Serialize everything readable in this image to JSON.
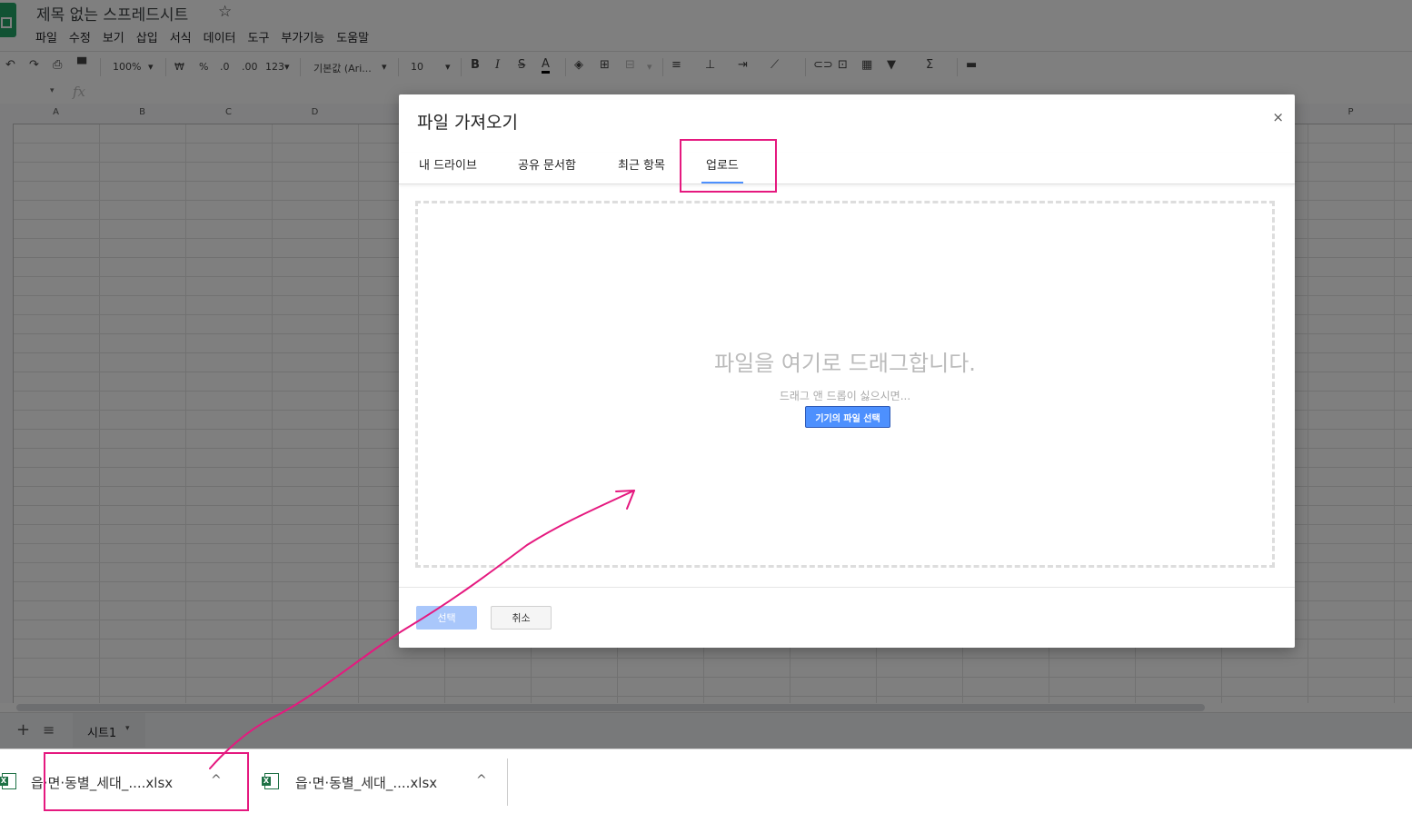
{
  "app": {
    "doc_title": "제목 없는 스프레드시트",
    "star_icon": "☆",
    "menu": [
      "파일",
      "수정",
      "보기",
      "삽입",
      "서식",
      "데이터",
      "도구",
      "부가기능",
      "도움말"
    ]
  },
  "toolbar": {
    "undo": "↶",
    "redo": "↷",
    "zoom": "100%",
    "currency": "₩",
    "percent": "%",
    "decimal_decrease": ".0",
    "decimal_increase": ".00",
    "number_format": "123▾",
    "font": "기본값 (Ari...",
    "font_size": "10",
    "bold": "B",
    "italic": "I",
    "strike": "S",
    "text_color": "A",
    "sum": "Σ",
    "dropdown_arrow": "▾"
  },
  "formula_bar": {
    "fx": "fx"
  },
  "columns": [
    "A",
    "B",
    "C",
    "D",
    "",
    "",
    "",
    "",
    "",
    "",
    "",
    "",
    "",
    "",
    "",
    "P"
  ],
  "sheet_tab": {
    "name": "시트1",
    "add": "+",
    "all": "≡"
  },
  "dialog": {
    "title": "파일 가져오기",
    "close": "×",
    "tabs": [
      "내 드라이브",
      "공유 문서함",
      "최근 항목",
      "업로드"
    ],
    "active_tab": "업로드",
    "dropzone_title": "파일을 여기로 드래그합니다.",
    "dropzone_sub": "드래그 앤 드롭이 싫으시면...",
    "choose_button": "기기의 파일 선택",
    "select_button": "선택",
    "cancel_button": "취소"
  },
  "downloads": [
    {
      "name": "읍·면·동별_세대_....xlsx",
      "chevron": "^"
    },
    {
      "name": "읍·면·동별_세대_....xlsx",
      "chevron": "^"
    }
  ],
  "colors": {
    "highlight": "#e5197f",
    "accent": "#4d90fe",
    "sheets_green": "#23a566"
  }
}
